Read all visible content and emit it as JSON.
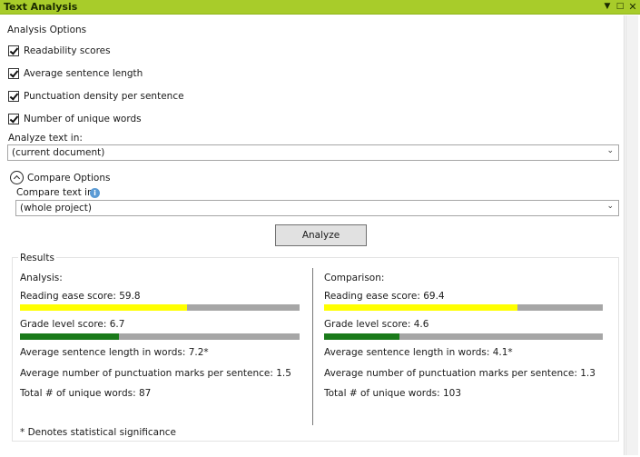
{
  "window": {
    "title": "Text Analysis"
  },
  "options": {
    "section_title": "Analysis Options",
    "checkboxes": [
      {
        "label": "Readability scores",
        "checked": true
      },
      {
        "label": "Average sentence length",
        "checked": true
      },
      {
        "label": "Punctuation density per sentence",
        "checked": true
      },
      {
        "label": "Number of unique words",
        "checked": true
      }
    ],
    "analyze_in_label": "Analyze text in:",
    "analyze_in_value": "(current document)"
  },
  "compare": {
    "toggle_label": "Compare Options",
    "text_in_label": "Compare text in:",
    "text_in_value": "(whole project)",
    "info_icon": "i"
  },
  "analyze_button": "Analyze",
  "results": {
    "title": "Results",
    "analysis": {
      "heading": "Analysis:",
      "reading_ease": "Reading ease score: 59.8",
      "reading_ease_value": 59.8,
      "grade_level": "Grade level score: 6.7",
      "grade_level_value": 6.7,
      "avg_sentence": "Average sentence length in words: 7.2*",
      "avg_punct": "Average number of punctuation marks per sentence: 1.5",
      "unique_words": "Total # of unique words: 87"
    },
    "comparison": {
      "heading": "Comparison:",
      "reading_ease": "Reading ease score: 69.4",
      "reading_ease_value": 69.4,
      "grade_level": "Grade level score: 4.6",
      "grade_level_value": 4.6,
      "avg_sentence": "Average sentence length in words: 4.1*",
      "avg_punct": "Average number of punctuation marks per sentence: 1.3",
      "unique_words": "Total # of unique words: 103"
    },
    "footnote": "* Denotes statistical significance"
  },
  "colors": {
    "title_bar": "#a8cc2a",
    "reading_ease_fill": "#ffff00",
    "grade_level_fill": "#1a7a1a",
    "bar_track": "#a6a6a6"
  }
}
